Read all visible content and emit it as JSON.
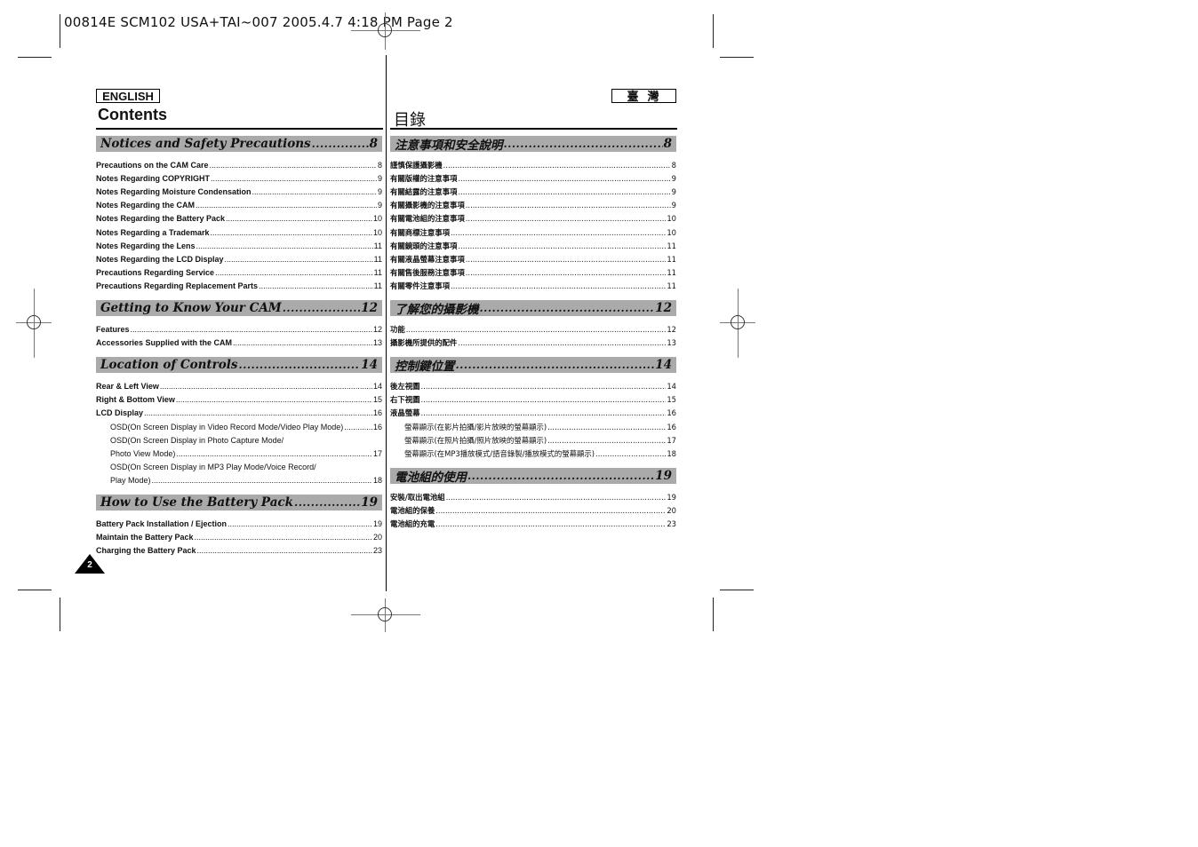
{
  "slug": "00814E SCM102 USA+TAI~007 2005.4.7 4:18 PM Page 2",
  "english": {
    "lang_label": "ENGLISH",
    "title": "Contents",
    "sections": [
      {
        "title": "Notices and Safety Precautions",
        "page": "8",
        "items": [
          {
            "label": "Precautions on the CAM Care",
            "page": "8"
          },
          {
            "label": "Notes Regarding COPYRIGHT",
            "page": "9"
          },
          {
            "label": "Notes Regarding Moisture Condensation",
            "page": "9"
          },
          {
            "label": "Notes Regarding the CAM",
            "page": "9"
          },
          {
            "label": "Notes Regarding the Battery Pack",
            "page": "10"
          },
          {
            "label": "Notes Regarding a Trademark",
            "page": "10"
          },
          {
            "label": "Notes Regarding the Lens",
            "page": "11"
          },
          {
            "label": "Notes Regarding the LCD Display",
            "page": "11"
          },
          {
            "label": "Precautions Regarding Service",
            "page": "11"
          },
          {
            "label": "Precautions Regarding Replacement Parts",
            "page": "11"
          }
        ]
      },
      {
        "title": "Getting to Know Your CAM",
        "page": "12",
        "items": [
          {
            "label": "Features",
            "page": "12"
          },
          {
            "label": "Accessories Supplied with the CAM",
            "page": "13"
          }
        ]
      },
      {
        "title": "Location of Controls",
        "page": "14",
        "items": [
          {
            "label": "Rear & Left View",
            "page": "14"
          },
          {
            "label": "Right & Bottom View",
            "page": "15"
          },
          {
            "label": "LCD Display",
            "page": "16"
          },
          {
            "label": "OSD(On Screen Display in Video Record Mode/Video Play Mode)",
            "page": "16",
            "sub": true
          },
          {
            "label": "OSD(On Screen Display in Photo Capture Mode/",
            "page": "",
            "sub": true
          },
          {
            "label": "Photo View Mode)",
            "page": "17",
            "sub": true
          },
          {
            "label": "OSD(On Screen Display in MP3 Play Mode/Voice Record/",
            "page": "",
            "sub": true
          },
          {
            "label": "Play Mode)",
            "page": "18",
            "sub": true
          }
        ]
      },
      {
        "title": "How to Use the Battery Pack",
        "page": "19",
        "items": [
          {
            "label": "Battery Pack Installation / Ejection",
            "page": "19"
          },
          {
            "label": "Maintain the Battery Pack",
            "page": "20"
          },
          {
            "label": "Charging the Battery Pack",
            "page": "23"
          }
        ]
      }
    ]
  },
  "taiwan": {
    "lang_label": "臺灣",
    "title": "目錄",
    "sections": [
      {
        "title": "注意事項和安全說明",
        "page": "8",
        "items": [
          {
            "label": "謹慎保護攝影機",
            "page": "8"
          },
          {
            "label": "有關版權的注意事項",
            "page": "9"
          },
          {
            "label": "有關結露的注意事項",
            "page": "9"
          },
          {
            "label": "有關攝影機的注意事項",
            "page": "9"
          },
          {
            "label": "有關電池組的注意事項",
            "page": "10"
          },
          {
            "label": "有關商標注意事項",
            "page": "10"
          },
          {
            "label": "有關鏡頭的注意事項",
            "page": "11"
          },
          {
            "label": "有關液晶螢幕注意事項",
            "page": "11"
          },
          {
            "label": "有關售後服務注意事項",
            "page": "11"
          },
          {
            "label": "有關零件注意事項",
            "page": "11"
          }
        ]
      },
      {
        "title": "了解您的攝影機",
        "page": "12",
        "items": [
          {
            "label": "功能",
            "page": "12"
          },
          {
            "label": "攝影機所提供的配件",
            "page": "13"
          }
        ]
      },
      {
        "title": "控制鍵位置",
        "page": "14",
        "items": [
          {
            "label": "後左視圖",
            "page": "14"
          },
          {
            "label": "右下視圖",
            "page": "15"
          },
          {
            "label": "液晶螢幕",
            "page": "16"
          },
          {
            "label": "螢幕顯示(在影片拍攝/影片放映的螢幕顯示)",
            "page": "16",
            "sub": true
          },
          {
            "label": "螢幕顯示(在照片拍攝/照片放映的螢幕顯示)",
            "page": "17",
            "sub": true
          },
          {
            "label": "螢幕顯示(在MP3播放模式/語音錄製/播放模式的螢幕顯示)",
            "page": "18",
            "sub": true
          }
        ]
      },
      {
        "title": "電池組的使用",
        "page": "19",
        "items": [
          {
            "label": "安裝/取出電池組",
            "page": "19"
          },
          {
            "label": "電池組的保養",
            "page": "20"
          },
          {
            "label": "電池組的充電",
            "page": "23"
          }
        ]
      }
    ]
  },
  "page_number": "2"
}
